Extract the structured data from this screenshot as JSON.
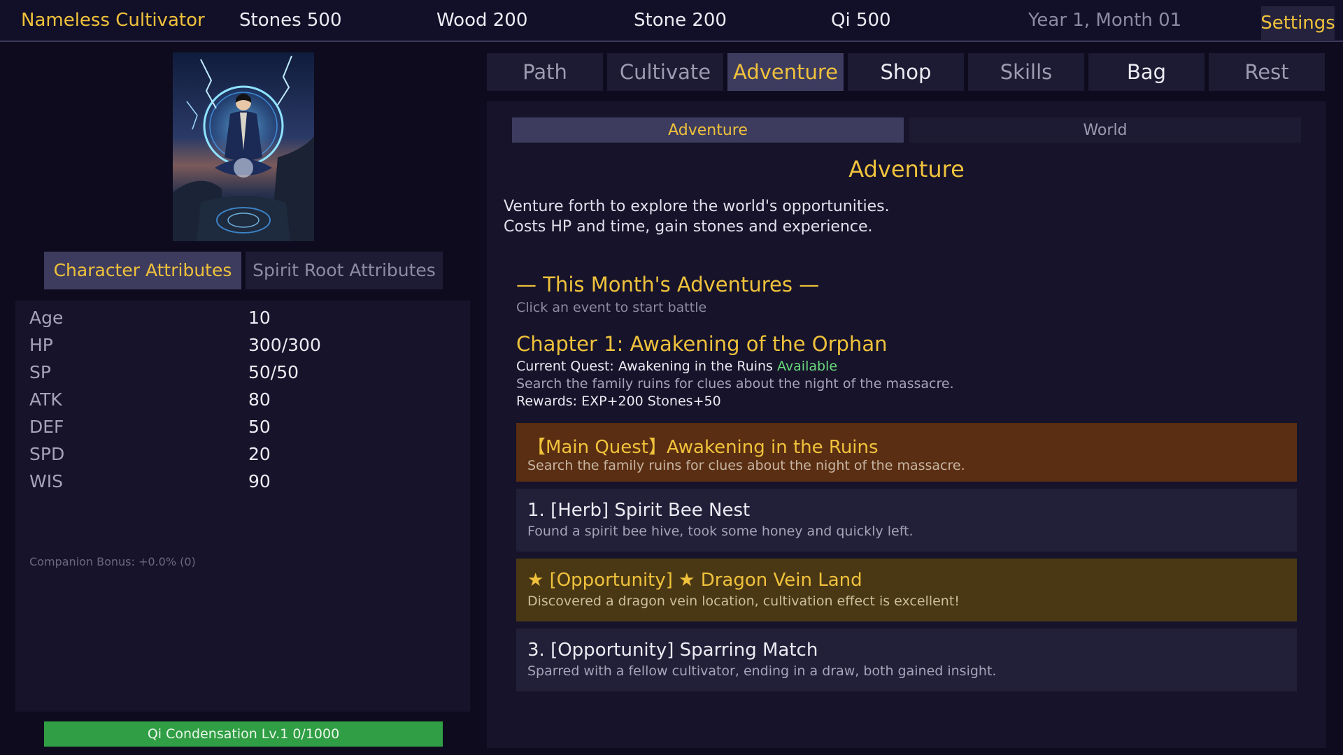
{
  "topbar": {
    "player_name": "Nameless Cultivator",
    "stones": "Stones 500",
    "wood": "Wood 200",
    "stone": "Stone 200",
    "qi": "Qi 500",
    "date": "Year 1, Month 01",
    "settings_label": "Settings"
  },
  "colors": {
    "accent_gold": "#f0c23c",
    "background": "#0e0b1f",
    "panel": "#16132a",
    "tab_active": "#3d3b5e",
    "main_quest": "#5a2e12",
    "opportunity": "#4a3814",
    "available_green": "#69db7c",
    "progress_green": "#2f9e44"
  },
  "left": {
    "attr_tabs": {
      "character": "Character Attributes",
      "spirit_root": "Spirit Root Attributes"
    },
    "attributes": [
      {
        "key": "Age",
        "value": "10"
      },
      {
        "key": "HP",
        "value": "300/300"
      },
      {
        "key": "SP",
        "value": "50/50"
      },
      {
        "key": "ATK",
        "value": "80"
      },
      {
        "key": "DEF",
        "value": "50"
      },
      {
        "key": "SPD",
        "value": "20"
      },
      {
        "key": "WIS",
        "value": "90"
      }
    ],
    "companion_bonus": "Companion Bonus: +0.0% (0)",
    "progress": {
      "label": "Qi Condensation Lv.1  0/1000",
      "fraction": 0.0
    }
  },
  "main_tabs": [
    "Path",
    "Cultivate",
    "Adventure",
    "Shop",
    "Skills",
    "Bag",
    "Rest"
  ],
  "content": {
    "sub_tabs": {
      "adventure": "Adventure",
      "world": "World"
    },
    "title": "Adventure",
    "desc_lines": [
      "Venture forth to explore the world's opportunities.",
      "Costs HP and time, gain stones and experience."
    ],
    "month_title": "— This Month's Adventures —",
    "month_hint": "Click an event to start battle",
    "chapter": {
      "title": "Chapter 1: Awakening of the Orphan",
      "quest_prefix": "Current Quest: Awakening in the Ruins",
      "quest_status": "Available",
      "quest_desc": "Search the family ruins for clues about the night of the massacre.",
      "rewards": "Rewards: EXP+200 Stones+50"
    },
    "events": {
      "main": {
        "title": "【Main Quest】Awakening in the Ruins",
        "desc": "Search the family ruins for clues about the night of the massacre."
      },
      "e1": {
        "title": "1. [Herb] Spirit Bee Nest",
        "desc": "Found a spirit bee hive, took some honey and quickly left."
      },
      "e2": {
        "title": "★ [Opportunity] ★ Dragon Vein Land",
        "desc": "Discovered a dragon vein location, cultivation effect is excellent!"
      },
      "e3": {
        "title": "3. [Opportunity] Sparring Match",
        "desc": "Sparred with a fellow cultivator, ending in a draw, both gained insight."
      }
    }
  }
}
